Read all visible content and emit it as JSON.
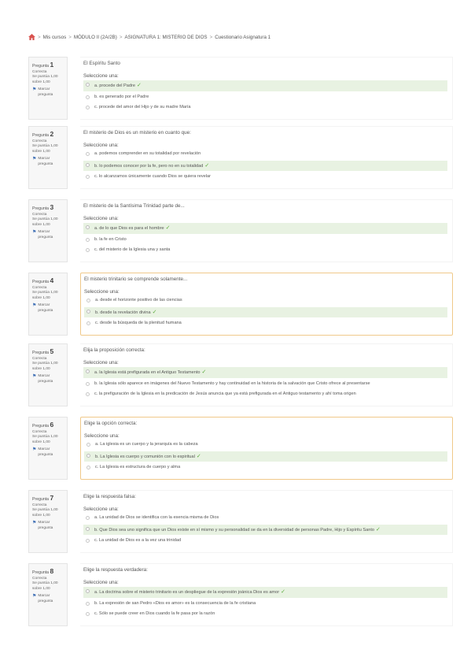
{
  "breadcrumb": {
    "items": [
      "Mis cursos",
      "MÓDULO II (2A/2B)",
      "ASIGNATURA 1: MISTERIO DE DIOS",
      "Cuestionario Asignatura 1"
    ],
    "separator": ">"
  },
  "labels": {
    "prompt": "Seleccione una:",
    "flag": "Marcar pregunta",
    "question_prefix": "Pregunta"
  },
  "questions": [
    {
      "number": "1",
      "state": "Correcta",
      "grade": "Se puntúa 1,00 sobre 1,00",
      "text": "El Espíritu Santo",
      "answers": [
        {
          "text": "a. procede del Padre",
          "selected": true
        },
        {
          "text": "b. es generado por el Padre",
          "selected": false
        },
        {
          "text": "c. procede del amor del Hijo y de su madre María",
          "selected": false
        }
      ]
    },
    {
      "number": "2",
      "state": "Correcta",
      "grade": "Se puntúa 1,00 sobre 1,00",
      "text": "El misterio de Dios es un misterio en cuanto que:",
      "answers": [
        {
          "text": "a. podemos comprender en su totalidad por revelación",
          "selected": false
        },
        {
          "text": "b. lo podemos conocer por la fe, pero no en su totalidad",
          "selected": true
        },
        {
          "text": "c. lo alcanzamos únicamente cuando Dios se quiera revelar",
          "selected": false
        }
      ]
    },
    {
      "number": "3",
      "state": "Correcta",
      "grade": "Se puntúa 1,00 sobre 1,00",
      "text": "El misterio de la Santísima Trinidad parte de...",
      "answers": [
        {
          "text": "a. de lo que Dios es para el hombre",
          "selected": true
        },
        {
          "text": "b. la fe en Cristo",
          "selected": false
        },
        {
          "text": "c. del misterio de la Iglesia una y santa",
          "selected": false
        }
      ]
    },
    {
      "number": "4",
      "state": "Correcta",
      "grade": "Se puntúa 1,00 sobre 1,00",
      "text": "El misterio trinitario se comprende solamente...",
      "answers": [
        {
          "text": "a. desde el horizonte positivo de las ciencias",
          "selected": false
        },
        {
          "text": "b. desde la revelación divina",
          "selected": true
        },
        {
          "text": "c. desde la búsqueda de la plenitud humana",
          "selected": false
        }
      ]
    },
    {
      "number": "5",
      "state": "Correcta",
      "grade": "Se puntúa 1,00 sobre 1,00",
      "text": "Elija la proposición correcta:",
      "answers": [
        {
          "text": "a. la Iglesia está prefigurada en el Antiguo Testamento",
          "selected": true
        },
        {
          "text": "b. la Iglesia sólo aparece en imágenes del Nuevo Testamento y hay continuidad en la historia de la salvación que Cristo ofrece al presentarse",
          "selected": false
        },
        {
          "text": "c. la prefiguración de la Iglesia en la predicación de Jesús anuncia que ya está prefigurada en el Antiguo testamento y ahí toma origen",
          "selected": false
        }
      ]
    },
    {
      "number": "6",
      "state": "Correcta",
      "grade": "Se puntúa 1,00 sobre 1,00",
      "text": "Elige la opción correcta:",
      "answers": [
        {
          "text": "a. La iglesia es un cuerpo y la jerarquía es la cabeza",
          "selected": false
        },
        {
          "text": "b. La Iglesia es cuerpo y comunión con lo espiritual",
          "selected": true
        },
        {
          "text": "c. La Iglesia es estructura de cuerpo y alma",
          "selected": false
        }
      ]
    },
    {
      "number": "7",
      "state": "Correcta",
      "grade": "Se puntúa 1,00 sobre 1,00",
      "text": "Elige la respuesta falsa:",
      "answers": [
        {
          "text": "a. La unidad de Dios se identifica con la esencia misma de Dios",
          "selected": false
        },
        {
          "text": "b. Que Dios sea uno significa que un Dios existe en sí mismo y su personalidad se da en la diversidad de personas Padre, Hijo y Espíritu Santo",
          "selected": true
        },
        {
          "text": "c. La unidad de Dios es a la vez una trinidad",
          "selected": false
        }
      ]
    },
    {
      "number": "8",
      "state": "Correcta",
      "grade": "Se puntúa 1,00 sobre 1,00",
      "text": "Elige la respuesta verdadera:",
      "answers": [
        {
          "text": "a. La doctrina sobre el misterio trinitario es un despliegue de la expresión joánica Dios es amor",
          "selected": true
        },
        {
          "text": "b. La expresión de san Pedro «Dios es amor» es la consecuencia de la fe cristiana",
          "selected": false
        },
        {
          "text": "c. Sólo se puede creer en Dios cuando la fe pasa por la razón",
          "selected": false
        }
      ]
    }
  ]
}
